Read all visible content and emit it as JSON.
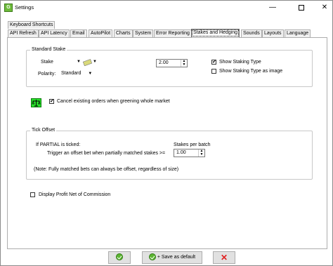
{
  "window": {
    "title": "Settings",
    "app_icon_letter": "G",
    "minimize_glyph": "—",
    "close_glyph": "✕"
  },
  "tabs": {
    "row1": [
      "Keyboard Shortcuts"
    ],
    "row2": [
      "API Refresh",
      "API Latency",
      "Email",
      "AutoPilot",
      "Charts",
      "System",
      "Error Reporting",
      "Stakes and Hedging",
      "Sounds",
      "Layouts",
      "Language"
    ],
    "active": "Stakes and Hedging"
  },
  "standard_stake": {
    "group_label": "Standard Stake",
    "stake_label": "Stake",
    "stake_value": "2.00",
    "polarity_label": "Polarity:",
    "polarity_value": "Standard",
    "show_staking_type": {
      "label": "Show Staking Type",
      "checked": true
    },
    "show_staking_type_as_image": {
      "label": "Show Staking Type as image",
      "checked": false
    }
  },
  "cancel_orders": {
    "label": "Cancel existing orders when greening whole market",
    "checked": true
  },
  "tick_offset": {
    "group_label": "Tick Offset",
    "partial_label": "If PARTIAL is ticked:",
    "stakes_per_batch_label": "Stakes per batch",
    "trigger_label": "Trigger an offset bet when partially matched stakes >=",
    "trigger_value": "1.00",
    "note": "(Note:  Fully matched bets can always be offset, regardless of size)"
  },
  "profit_net": {
    "label": "Display Profit Net of Commission",
    "checked": false
  },
  "buttons": {
    "save_default_label": "+ Save as default"
  },
  "icons": {
    "ok": "ok-icon",
    "cancel": "cancel-icon",
    "scales": "scales-icon"
  },
  "colors": {
    "ok_green": "#5cb531",
    "cancel_red": "#e02020",
    "greening_icon": "#27e02a"
  }
}
